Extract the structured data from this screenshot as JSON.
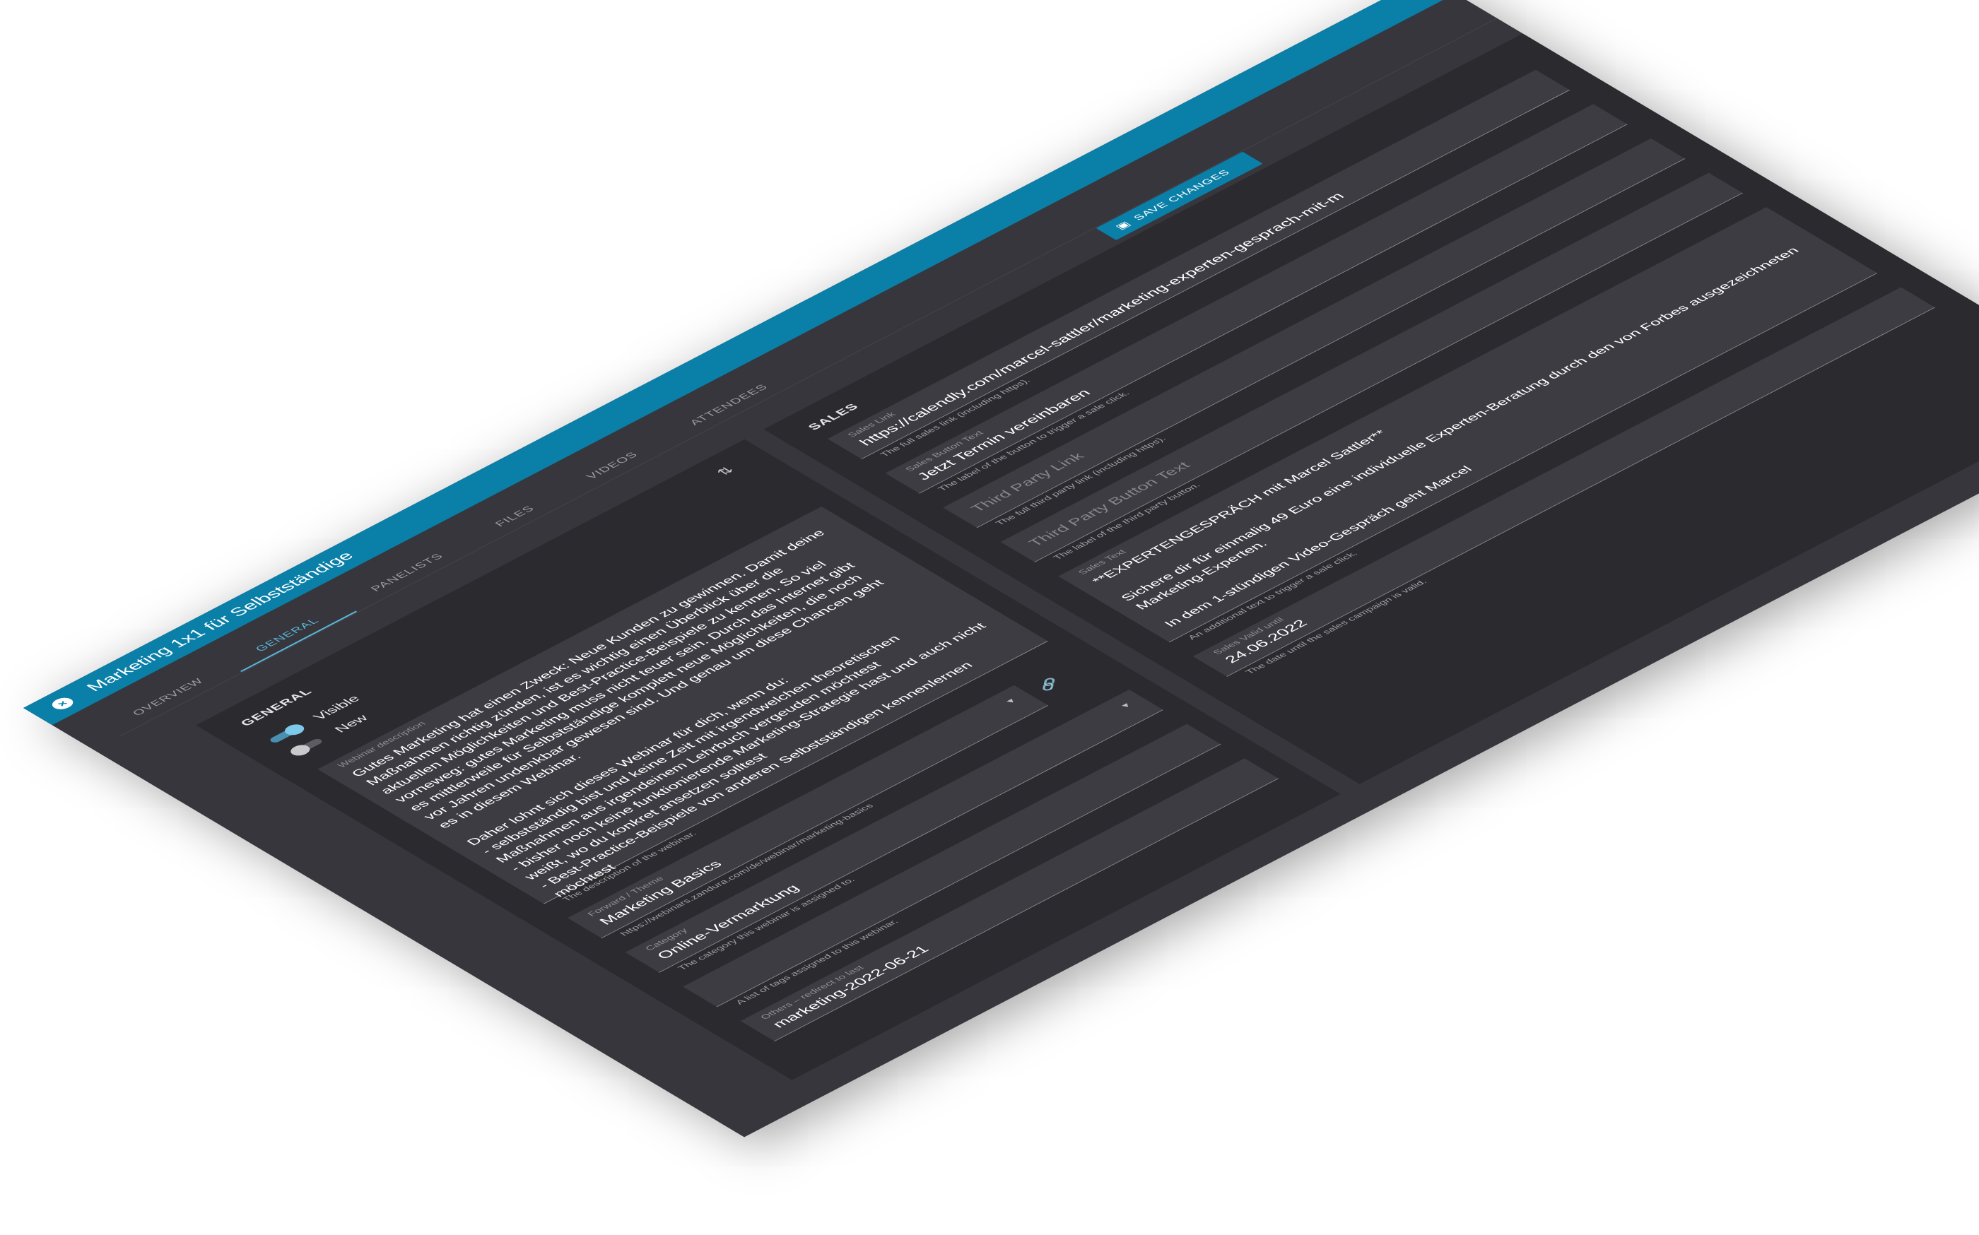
{
  "window": {
    "title": "Marketing 1x1 für Selbstständige",
    "close_icon": "close-icon",
    "accent": "#0a7fa8"
  },
  "tabs": [
    {
      "label": "OVERVIEW",
      "active": false
    },
    {
      "label": "GENERAL",
      "active": true
    },
    {
      "label": "PANELISTS",
      "active": false
    },
    {
      "label": "FILES",
      "active": false
    },
    {
      "label": "VIDEOS",
      "active": false
    },
    {
      "label": "ATTENDEES",
      "active": false
    }
  ],
  "toolbar": {
    "save_label": "SAVE CHANGES",
    "save_icon": "floppy-disk-icon"
  },
  "general": {
    "title": "GENERAL",
    "visible_label": "Visible",
    "visible": true,
    "new_label": "New",
    "new": false,
    "description": {
      "label": "Webinar description",
      "value": "Gutes Marketing hat einen Zweck: Neue Kunden zu gewinnen. Damit deine Maßnahmen richtig zünden, ist es wichtig einen Überblick über die aktuellen Möglichkeiten und Best-Practice-Beispiele zu kennen. So viel vorneweg: gutes Marketing muss nicht teuer sein. Durch das Internet gibt es mittlerweile für Selbstständige komplett neue Möglichkeiten, die noch vor Jahren undenkbar gewesen sind. Und genau um diese Chancen geht es in diesem Webinar.\n\nDaher lohnt sich dieses Webinar für dich, wenn du:\n- selbstständig bist und keine Zeit mit irgendwelchen theoretischen Maßnahmen aus irgendeinem Lehrbuch vergeuden möchtest\n- bisher noch keine funktionierende Marketing-Strategie hast und auch nicht weißt, wo du konkret ansetzen solltest\n- Best-Practice-Beispiele von anderen Selbstständigen kennenlernen möchtest",
      "help": "The description of the webinar."
    },
    "forward": {
      "label": "Forward / Theme",
      "value": "Marketing Basics",
      "help": "https://webinars.zandura.com/de/webinar/marketing-basics"
    },
    "category": {
      "label": "Category",
      "value": "Online-Vermarktung",
      "help": "The category this webinar is assigned to."
    },
    "tags": {
      "help": "A list of tags assigned to this webinar."
    },
    "others": {
      "label": "Others – redirect to last",
      "value": "marketing-2022-06-21"
    }
  },
  "sales": {
    "title": "SALES",
    "link": {
      "label": "Sales Link",
      "value": "https://calendly.com/marcel-sattler/marketing-experten-gesprach-mit-m",
      "help": "The full sales link (including https)."
    },
    "button_text": {
      "label": "Sales Button Text",
      "value": "Jetzt Termin vereinbaren",
      "help": "The label of the button to trigger a sale click."
    },
    "third_party_link": {
      "placeholder": "Third Party Link",
      "help": "The full third party link (including https)."
    },
    "third_party_button": {
      "placeholder": "Third Party Button Text",
      "help": "The label of the third party button."
    },
    "text": {
      "label": "Sales Text",
      "value": "**EXPERTENGESPRÄCH mit Marcel Sattler**\n\nSichere dir für einmalig 49 Euro eine individuelle Experten-Beratung durch den von Forbes ausgezeichneten Marketing-Experten.\n\nIn dem 1-stündigen Video-Gespräch geht Marcel",
      "help": "An additional text to trigger a sale click."
    },
    "valid_until": {
      "label": "Sales Valid until",
      "value": "24.06.2022",
      "help": "The date until the sales campaign is valid."
    }
  }
}
